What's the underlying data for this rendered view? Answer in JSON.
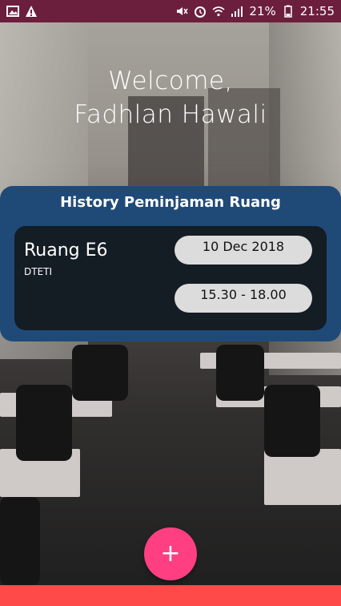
{
  "statusbar": {
    "battery": "21%",
    "time": "21:55",
    "icons_left": [
      "image-icon",
      "warning-icon"
    ],
    "icons_right": [
      "mute-icon",
      "alarm-icon",
      "wifi-icon",
      "signal-icon",
      "battery-icon"
    ]
  },
  "welcome": {
    "line1": "Welcome,",
    "line2": "Fadhlan Hawali"
  },
  "history": {
    "title": "History Peminjaman Ruang",
    "room": "Ruang E6",
    "dept": "DTETI",
    "date": "10 Dec 2018",
    "time": "15.30 - 18.00"
  },
  "fab": {
    "label": "+"
  },
  "colors": {
    "statusbar": "#6b1f3c",
    "panel": "#1f4a78",
    "card": "#141c24",
    "pill": "#dcdcdc",
    "fab": "#ff3f81",
    "bottombar": "#ff4a4a"
  }
}
